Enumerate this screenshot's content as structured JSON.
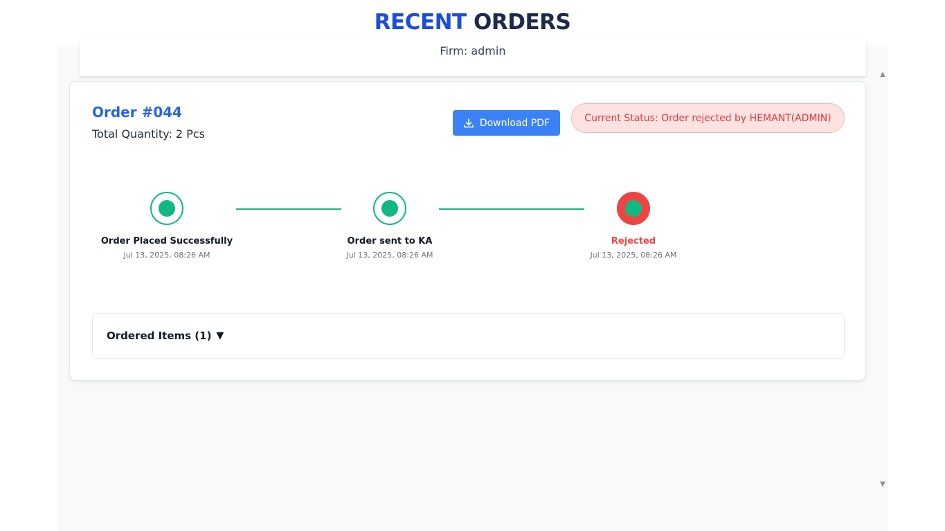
{
  "header": {
    "title_accent": "RECENT",
    "title_rest": "ORDERS"
  },
  "firm": {
    "text": "Firm: admin"
  },
  "scrollbar": {
    "up_arrow": "▲",
    "down_arrow": "▼"
  },
  "order": {
    "title": "Order #044",
    "total_quantity": "Total Quantity: 2 Pcs",
    "download_label": "Download PDF",
    "status_text": "Current Status: Order rejected by HEMANT(ADMIN)",
    "timeline": [
      {
        "label": "Order Placed Successfully",
        "date": "Jul 13, 2025, 08:26 AM",
        "state": "done"
      },
      {
        "label": "Order sent to KA",
        "date": "Jul 13, 2025, 08:26 AM",
        "state": "done"
      },
      {
        "label": "Rejected",
        "date": "Jul 13, 2025, 08:26 AM",
        "state": "rejected"
      }
    ],
    "items_toggle_label": "Ordered Items (1)",
    "items_toggle_caret": "▼"
  },
  "colors": {
    "accent_blue": "#1d4ed8",
    "button_blue": "#3b82f6",
    "success_green": "#10b981",
    "danger_red": "#ef4444",
    "status_bg": "#fde2e2"
  },
  "icons": {
    "download": "download-icon"
  }
}
